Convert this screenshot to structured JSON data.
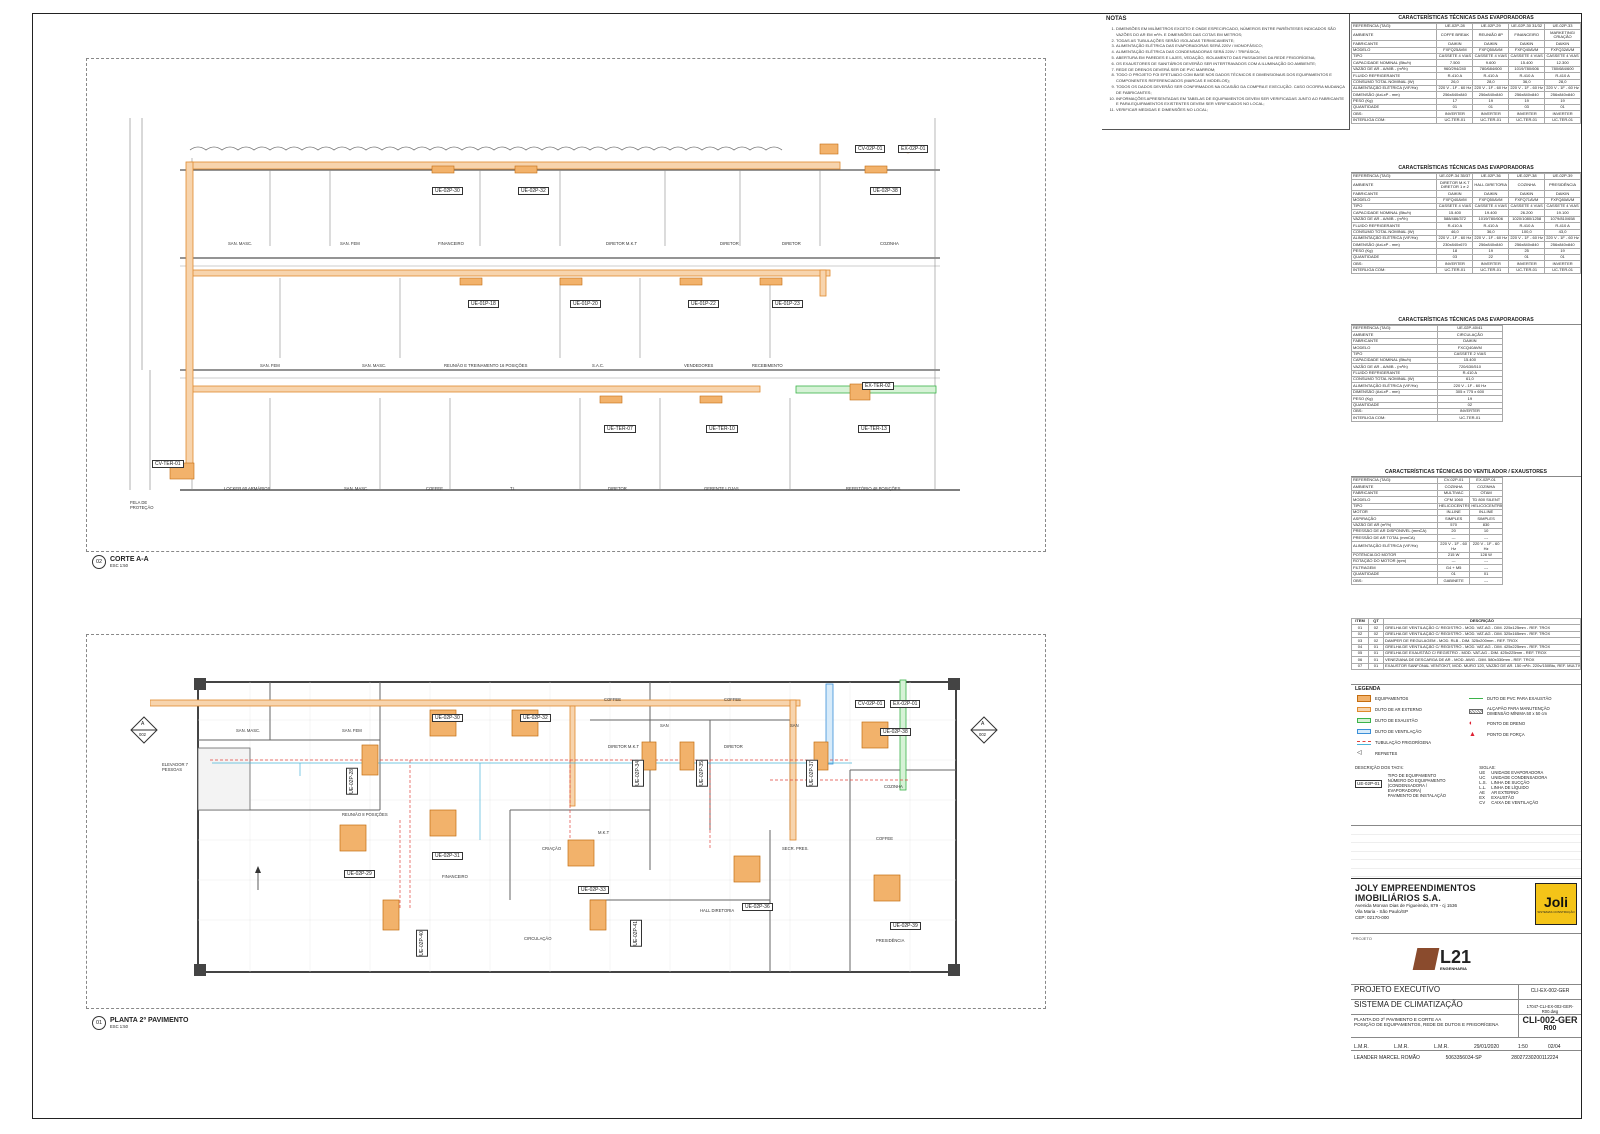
{
  "notes": {
    "title": "NOTAS",
    "items": [
      "DIMENSÕES EM MILÍMETROS EXCETO E ONDE ESPECIFICADO, NÚMEROS ENTRE PARÊNTESES INDICADOS SÃO VAZÕES DO AR EM m³/h. E DIMENSÕES DAS COTAS EM METROS;",
      "TODAS AS TUBULAÇÕES SERÃO ISOLADAS TERMICAMENTE;",
      "ALIMENTAÇÃO ELÉTRICA DAS EVAPORADORAS SERÁ 220V / MONOFÁSICO;",
      "ALIMENTAÇÃO ELÉTRICA DAS CONDENSADORAS SERÁ 220V / TRIFÁSICA;",
      "ABERTURA EM PAREDES E LAJES, VEDAÇÃO, ISOLAMENTO DAS PASSAGENS DA REDE FRIGORÍGENA;",
      "OS EXAUSTORES DE SANITÁRIOS DEVERÃO SER INTERTRAVADOS COM A ILUMINAÇÃO DO AMBIENTE;",
      "REDE DE DRENOS DEVERÁ SER DE PVC MARROM;",
      "TODO O PROJETO FOI EFETUADO COM BASE NOS DADOS TÉCNICOS E DIMENSIONAIS DOS EQUIPAMENTOS E COMPONENTES REFERENCIADOS (MARCAS E MODELOS);",
      "TODOS OS DADOS DEVERÃO SER CONFIRMADOS NA OCASIÃO DA COMPRA E EXECUÇÃO. CASO OCORRA MUDANÇA DE FABRICANTES;",
      "INFORMAÇÕES APRESENTADAS EM TABELAS DE EQUIPAMENTOS DEVEM SER VERIFICADAS JUNTO AO FABRICANTE E PARA EQUIPAMENTOS EXISTENTES DEVEM SER VERIFICADOS NO LOCAL;",
      "VERIFICAR MEDIDAS E DIMENSÕES NO LOCAL;"
    ]
  },
  "evap1": {
    "title": "CARACTERÍSTICAS TÉCNICAS DAS EVAPORADORAS",
    "cols": [
      "UE-02P-28",
      "UE-02P-29",
      "UE-02P-30 31/32",
      "UE-02P-33"
    ],
    "rows": [
      [
        "REFERÊNCIA (TAG):",
        "UE-02P-28",
        "UE-02P-29",
        "UE-02P-30 31/32",
        "UE-02P-33"
      ],
      [
        "AMBIENTE",
        "COFFE BREAK",
        "REUNIÃO 8P",
        "FINANCEIRO",
        "MARKETING/ CRIAÇÃO"
      ],
      [
        "FABRICANTE",
        "DAIKIN",
        "DAIKIN",
        "DAIKIN",
        "DAIKIN"
      ],
      [
        "MODELO",
        "FXFQ25AVM",
        "FXFQ50AVM",
        "FXFQ40AVM",
        "FXFQ32AVM"
      ],
      [
        "TIPO",
        "CASSETE 4 VIAS",
        "CASSETE 4 VIAS",
        "CASSETE 4 VIAS",
        "CASSETE 4 VIAS"
      ],
      [
        "CAPACIDADE NOMINAL (Btu/h)",
        "7.500",
        "9.600",
        "15.400",
        "12.300"
      ],
      [
        "VAZÃO DE AR - A/M/B - (m³/h)",
        "960/294/240",
        "780/684/600",
        "1019/780/606",
        "780/684/600"
      ],
      [
        "FLUIDO REFRIGERANTE",
        "R-410 A",
        "R-410 A",
        "R-410 A",
        "R-410 A"
      ],
      [
        "CONSUMO TOTAL NOMINAL (W)",
        "26,0",
        "28,0",
        "36,0",
        "28,0"
      ],
      [
        "ALIMENTAÇÃO ELÉTRICA (V/F/Hz)",
        "220 V - 1F - 60 Hz",
        "220 V - 1F - 60 Hz",
        "220 V - 1F - 60 Hz",
        "220 V - 1F - 60 Hz"
      ],
      [
        "DIMENSÃO (AxLxP - mm)",
        "256x840x840",
        "256x840x840",
        "256x840x840",
        "256x840x840"
      ],
      [
        "PESO (Kg)",
        "17",
        "19",
        "19",
        "19"
      ],
      [
        "QUANTIDADE",
        "01",
        "01",
        "03",
        "01"
      ],
      [
        "OBS:",
        "INVERTER",
        "INVERTER",
        "INVERTER",
        "INVERTER"
      ],
      [
        "INTERLIGA COM:",
        "UC-TER-01",
        "UC-TER-01",
        "UC-TER-01",
        "UC-TER-01"
      ]
    ]
  },
  "evap2": {
    "title": "CARACTERÍSTICAS TÉCNICAS DAS EVAPORADORAS",
    "rows": [
      [
        "REFERÊNCIA (TAG):",
        "UE-02P-34 35/37",
        "UE-02P-36",
        "UE-02P-38",
        "UE-02P-39"
      ],
      [
        "AMBIENTE",
        "DIRETOR M.K.T DIRETOR 1 e 2",
        "HALL DIRETORIA",
        "COZINHA",
        "PRESIDÊNCIA"
      ],
      [
        "FABRICANTE",
        "DAIKIN",
        "DAIKIN",
        "DAIKIN",
        "DAIKIN"
      ],
      [
        "MODELO",
        "FXFQ40AVM",
        "FXFQ50AVM",
        "FXFQ71AVM",
        "FXFQ80AVM"
      ],
      [
        "TIPO",
        "CASSETE 4 VIAS",
        "CASSETE 4 VIAS",
        "CASSETE 4 VIAS",
        "CASSETE 4 VIAS"
      ],
      [
        "CAPACIDADE NOMINAL (Btu/h)",
        "15.400",
        "19.400",
        "26.200",
        "19.100"
      ],
      [
        "VAZÃO DE AR - A/M/B - (m³/h)",
        "588/486/372",
        "1019/780/606",
        "1020/1080/1258",
        "1079/810/658"
      ],
      [
        "FLUIDO REFRIGERANTE",
        "R-410 A",
        "R-410 A",
        "R-410 A",
        "R-410 A"
      ],
      [
        "CONSUMO TOTAL NOMINAL (W)",
        "46,0",
        "36,0",
        "100,0",
        "43,0"
      ],
      [
        "ALIMENTAÇÃO ELÉTRICA (V/F/Hz)",
        "220 V - 1F - 60 Hz",
        "220 V - 1F - 60 Hz",
        "220 V - 1F - 60 Hz",
        "220 V - 1F - 60 Hz"
      ],
      [
        "DIMENSÃO (AxLxP - mm)",
        "230x840x670",
        "256x840x840",
        "256x840x840",
        "256x840x840"
      ],
      [
        "PESO (Kg)",
        "18",
        "19",
        "25",
        "19"
      ],
      [
        "QUANTIDADE",
        "03",
        "22",
        "01",
        "01"
      ],
      [
        "OBS:",
        "INVERTER",
        "INVERTER",
        "INVERTER",
        "INVERTER"
      ],
      [
        "INTERLIGA COM:",
        "UC-TER-01",
        "UC-TER-01",
        "UC-TER-01",
        "UC-TER-01"
      ]
    ]
  },
  "evap3": {
    "title": "CARACTERÍSTICAS TÉCNICAS DAS EVAPORADORAS",
    "rows": [
      [
        "REFERÊNCIA (TAG):",
        "UE-02P-40/41"
      ],
      [
        "AMBIENTE",
        "CIRCULAÇÃO"
      ],
      [
        "FABRICANTE",
        "DAIKIN"
      ],
      [
        "MODELO",
        "FXCQ40AVM"
      ],
      [
        "TIPO",
        "CASSETE 2 VIAS"
      ],
      [
        "CAPACIDADE NOMINAL (Btu/h)",
        "15.400"
      ],
      [
        "VAZÃO DE AR - A/M/B - (m³/h)",
        "720/630/510"
      ],
      [
        "FLUIDO REFRIGERANTE",
        "R-410 A"
      ],
      [
        "CONSUMO TOTAL NOMINAL (W)",
        "61,0"
      ],
      [
        "ALIMENTAÇÃO ELÉTRICA (V/F/Hz)",
        "220 V - 1F - 60 Hz"
      ],
      [
        "DIMENSÃO (AxLxP - mm)",
        "305 x 775 x 600"
      ],
      [
        "PESO (Kg)",
        "19"
      ],
      [
        "QUANTIDADE",
        "02"
      ],
      [
        "OBS:",
        "INVERTER"
      ],
      [
        "INTERLIGA COM:",
        "UC-TER-01"
      ]
    ]
  },
  "vent": {
    "title": "CARACTERÍSTICAS TÉCNICAS DO VENTILADOR / EXAUSTORES",
    "rows": [
      [
        "REFERÊNCIA (TAG):",
        "CV-02P-01",
        "EX-02P-01"
      ],
      [
        "AMBIENTE",
        "COZINHA",
        "COZINHA"
      ],
      [
        "FABRICANTE",
        "MULTIVAC",
        "OTAM"
      ],
      [
        "MODELO",
        "CFM 1060",
        "TD 800 SILENT"
      ],
      [
        "TIPO",
        "HELICOCENTRÍF.",
        "HELICOCENTRÍF."
      ],
      [
        "MOTOR",
        "IN-LINE",
        "IN-LINE"
      ],
      [
        "ASPIRAÇÃO",
        "SIMPLES",
        "SIMPLES"
      ],
      [
        "VAZÃO DE AR (m³/h)",
        "570",
        "830"
      ],
      [
        "PRESSÃO DE AR DISPONÍVEL (mmCA)",
        "20",
        "10"
      ],
      [
        "PRESSÃO DE AR TOTAL (mmCA)",
        "---",
        "---"
      ],
      [
        "ALIMENTAÇÃO ELÉTRICA (V/F/Hz)",
        "220 V - 1F - 60 Hz",
        "220 V - 1F - 60 Hz"
      ],
      [
        "POTÊNCIA DO MOTOR",
        "215 W",
        "128 W"
      ],
      [
        "ROTAÇÃO DO MOTOR (rpm)",
        "---",
        "---"
      ],
      [
        "FILTRAGEM",
        "G4 + M5",
        "---"
      ],
      [
        "QUANTIDADE",
        "01",
        "01"
      ],
      [
        "OBS:",
        "GABINETE",
        "---"
      ]
    ]
  },
  "items": {
    "head_item": "ITEM",
    "head_qt": "QT",
    "head_desc": "DESCRIÇÃO",
    "rows": [
      [
        "01",
        "02",
        "GRELHA DE VENTILAÇÃO C/ REGISTRO - MOD. VAT-AG - DIM. 225x125mm - REF. TROX"
      ],
      [
        "02",
        "02",
        "GRELHA DE VENTILAÇÃO C/ REGISTRO - MOD. VAT-AG - DIM. 325x165mm - REF. TROX"
      ],
      [
        "03",
        "02",
        "DAMPER DE REGULAGEM - MOD. RLB - DIM. 325x200mm - REF. TROX"
      ],
      [
        "04",
        "01",
        "GRELHA DE VENTILAÇÃO C/ REGISTRO - MOD. VAT-AG - DIM. 425x225mm - REF. TROX"
      ],
      [
        "05",
        "01",
        "GRELHA DE EXAUSTÃO C/ REGISTRO - MOD. VAT-AG - DIM. 425x225mm - REF. TROX"
      ],
      [
        "06",
        "01",
        "VENEZIANA DE DESCARGA DE AR - MOD. AWG - DIM. 580x330mm - REF. TROX"
      ],
      [
        "07",
        "01",
        "EXAUSTOR SANFONAL VENTOKIT, MOD. MURO 120, VAZÃO DE AR. 150 m³/h. 220v/150Btu, REF. MULTIVAC"
      ]
    ]
  },
  "legend": {
    "title": "LEGENDA",
    "left": [
      {
        "label": "EQUIPAMENTOS",
        "kind": "equip"
      },
      {
        "label": "DUTO DE AR EXTERNO",
        "kind": "orange"
      },
      {
        "label": "DUTO DE EXAUSTÃO",
        "kind": "green"
      },
      {
        "label": "DUTO DE VENTILAÇÃO",
        "kind": "blue"
      },
      {
        "label": "TUBULAÇÃO FRIGORÍGENA",
        "kind": "refrig"
      },
      {
        "label": "REFNETES",
        "kind": "refnet"
      }
    ],
    "right": [
      {
        "label": "DUTO DE PVC PARA EXAUSTÃO",
        "kind": "pvc"
      },
      {
        "label": "ALÇAPÃO PARA MANUTENÇÃO DIMENSÃO MÍNIMA 50 x 50 cm",
        "kind": "hatch"
      },
      {
        "label": "PONTO DE DRENO",
        "kind": "drain"
      },
      {
        "label": "PONTO DE FORÇA",
        "kind": "force"
      }
    ],
    "tag_desc_title": "DESCRIÇÃO DOS TAG's:",
    "tag_desc": [
      "TIPO DE EQUIPAMENTO",
      "NÚMERO DO EQUIPAMENTO (CONDENSADORA / EVAPORADORA)",
      "PAVIMENTO DE INSTALAÇÃO"
    ],
    "tag_example": "UE-02P-01",
    "siglas_title": "SIGLAS:",
    "siglas": [
      [
        "UE",
        "UNIDADE EVAPORADORA"
      ],
      [
        "UC",
        "UNIDADE CONDENSADORA"
      ],
      [
        "L.S.",
        "LINHA DE SUCÇÃO"
      ],
      [
        "L.L.",
        "LINHA DE LÍQUIDO"
      ],
      [
        "AE",
        "AR EXTERNO"
      ],
      [
        "EX",
        "EXAUSTÃO"
      ],
      [
        "CV",
        "CAIXA DE VENTILAÇÃO"
      ]
    ]
  },
  "title_block": {
    "client": "JOLY EMPREENDIMENTOS IMOBILIÁRIOS S.A.",
    "address": [
      "Avenida Morvan Dias de Figueiredo, 879 - cj 1536",
      "Vila Maria - São Paulo/SP",
      "CEP: 02170-000"
    ],
    "client_logo": "Joli",
    "client_logo_sub": "SISTEMAS CONSTRUÇÃO",
    "projetista_label": "PROJETO",
    "designer_logo": "L21",
    "designer_logo_sub": "ENGENHARIA",
    "stage": "PROJETO EXECUTIVO",
    "discipline": "SISTEMA DE CLIMATIZAÇÃO",
    "code_right": "CLI-EX-002-GER",
    "file_name": "17047-CLI-EX-002-GER-R00.dwg",
    "sheet_desc": [
      "PLANTA DO 2º PAVIMENTO E CORTE AA",
      "POSIÇÃO DE EQUIPAMENTOS, REDE DE DUTOS E FRIGORÍGENA"
    ],
    "sheet_code": "CLI-002-GER",
    "revision": "R00",
    "drawn": "L.M.R.",
    "checked": "L.M.R.",
    "approved": "L.M.R.",
    "date": "29/01/2020",
    "scale": "1:50",
    "sheet": "02/04",
    "resp": "LEANDER MARCEL ROMÃO",
    "crea": "5063356034-SP",
    "art": "28027230200112224"
  },
  "section": {
    "number": "02",
    "title": "CORTE A-A",
    "scale": "ESC 1:50",
    "equip_tags": [
      "UE-02P-30",
      "UE-02P-32",
      "UE-02P-38",
      "UE-01P-18",
      "UE-01P-20",
      "UE-01P-22",
      "UE-01P-23",
      "UE-TER-07",
      "UE-TER-10",
      "UE-TER-13"
    ],
    "box_tags": [
      "CV-02P-01",
      "EX-02P-01",
      "EX-TER-02",
      "CV-TER-01"
    ],
    "rooms_top": [
      "SAN. MASC.",
      "SAN. FEM",
      "FINANCEIRO",
      "DIRETOR M.K.T",
      "DIRETOR",
      "DIRETOR",
      "COZINHA"
    ],
    "rooms_mid": [
      "SAN. FEM",
      "SAN. MASC.",
      "REUNIÃO E TREINAMENTO 16 POSIÇÕES",
      "S.A.C.",
      "VENDEDORES",
      "RECEBIMENTO"
    ],
    "rooms_bot": [
      "LOCKER 60 ARMÁRIOS",
      "SAN. MASC.",
      "COFFEE",
      "T.I.",
      "DIRETOR",
      "GERENTE LOJAS",
      "REFEITÓRIO 48 POSIÇÕES"
    ],
    "guard_label": "FELA DE PROTEÇÃO"
  },
  "plan": {
    "number": "01",
    "title": "PLANTA 2º PAVIMENTO",
    "scale": "ESC 1:50",
    "cut_label": "A",
    "cut_sheet": "002",
    "equip_tags": [
      "UE-02P-30",
      "UE-02P-32",
      "UE-02P-28",
      "UE-02P-29",
      "UE-02P-31",
      "UE-02P-33",
      "UE-02P-34",
      "UE-02P-35",
      "UE-02P-37",
      "UE-02P-38",
      "UE-02P-36",
      "UE-02P-39",
      "UE-02P-40",
      "UE-02P-41"
    ],
    "box_tags": [
      "CV-02P-01",
      "EX-02P-01"
    ],
    "rooms": [
      "SAN. MASC.",
      "SAN. FEM",
      "ELEVADOR 7 PESSOAS",
      "REUNIÃO 8 POSIÇÕES",
      "FINANCEIRO",
      "CRIAÇÃO",
      "M.K.T",
      "DIRETOR M.K.T",
      "DIRETOR",
      "SECR. PRES.",
      "HALL DIRETORIA",
      "COZINHA",
      "COFFEE",
      "CIRCULAÇÃO",
      "PRESIDÊNCIA",
      "COFFEE",
      "COFFEE",
      "SAN",
      "SAN"
    ]
  }
}
